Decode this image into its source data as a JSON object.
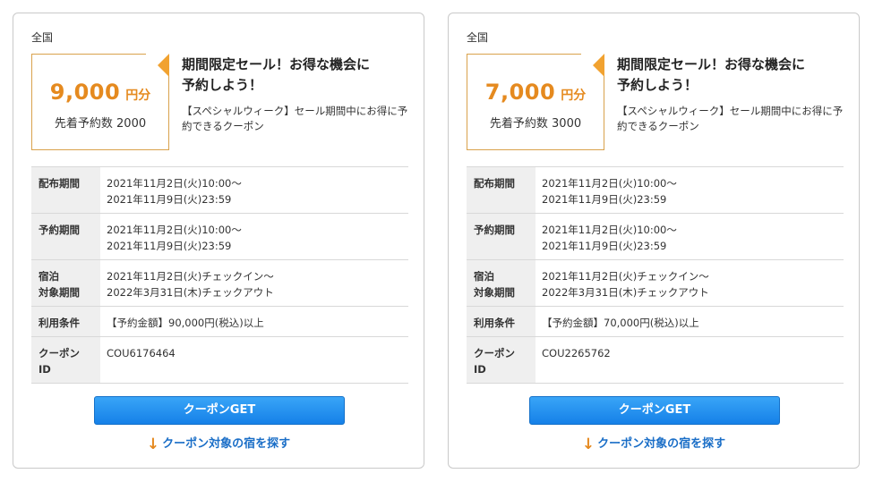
{
  "cards": [
    {
      "region": "全国",
      "amount": "9,000",
      "amount_unit": "円分",
      "first_come": "先着予約数 2000",
      "headline_line1": "期間限定セール！お得な機会に",
      "headline_line2": "予約しよう！",
      "description": "【スペシャルウィーク】セール期間中にお得に予約できるクーポン",
      "rows": {
        "distribution_label": "配布期間",
        "distribution_line1": "2021年11月2日(火)10:00～",
        "distribution_line2": "2021年11月9日(火)23:59",
        "booking_label": "予約期間",
        "booking_line1": "2021年11月2日(火)10:00～",
        "booking_line2": "2021年11月9日(火)23:59",
        "stay_label_line1": "宿泊",
        "stay_label_line2": "対象期間",
        "stay_line1": "2021年11月2日(火)チェックイン～",
        "stay_line2": "2022年3月31日(木)チェックアウト",
        "conditions_label": "利用条件",
        "conditions_value": "【予約金額】90,000円(税込)以上",
        "coupon_id_label_line1": "クーポン",
        "coupon_id_label_line2": "ID",
        "coupon_id_value": "COU6176464"
      },
      "get_button_label": "クーポンGET",
      "search_arrow": "↓",
      "search_link_label": "クーポン対象の宿を探す"
    },
    {
      "region": "全国",
      "amount": "7,000",
      "amount_unit": "円分",
      "first_come": "先着予約数 3000",
      "headline_line1": "期間限定セール！お得な機会に",
      "headline_line2": "予約しよう！",
      "description": "【スペシャルウィーク】セール期間中にお得に予約できるクーポン",
      "rows": {
        "distribution_label": "配布期間",
        "distribution_line1": "2021年11月2日(火)10:00～",
        "distribution_line2": "2021年11月9日(火)23:59",
        "booking_label": "予約期間",
        "booking_line1": "2021年11月2日(火)10:00～",
        "booking_line2": "2021年11月9日(火)23:59",
        "stay_label_line1": "宿泊",
        "stay_label_line2": "対象期間",
        "stay_line1": "2021年11月2日(火)チェックイン～",
        "stay_line2": "2022年3月31日(木)チェックアウト",
        "conditions_label": "利用条件",
        "conditions_value": "【予約金額】70,000円(税込)以上",
        "coupon_id_label_line1": "クーポン",
        "coupon_id_label_line2": "ID",
        "coupon_id_value": "COU2265762"
      },
      "get_button_label": "クーポンGET",
      "search_arrow": "↓",
      "search_link_label": "クーポン対象の宿を探す"
    }
  ],
  "colors": {
    "accent_orange": "#e58a1f",
    "corner_orange": "#f1a230",
    "button_blue": "#1580e8",
    "link_blue": "#1a6ec7",
    "label_bg": "#efefef"
  },
  "icons": {
    "corner": "folded-corner-icon",
    "arrow": "arrow-down-icon"
  }
}
